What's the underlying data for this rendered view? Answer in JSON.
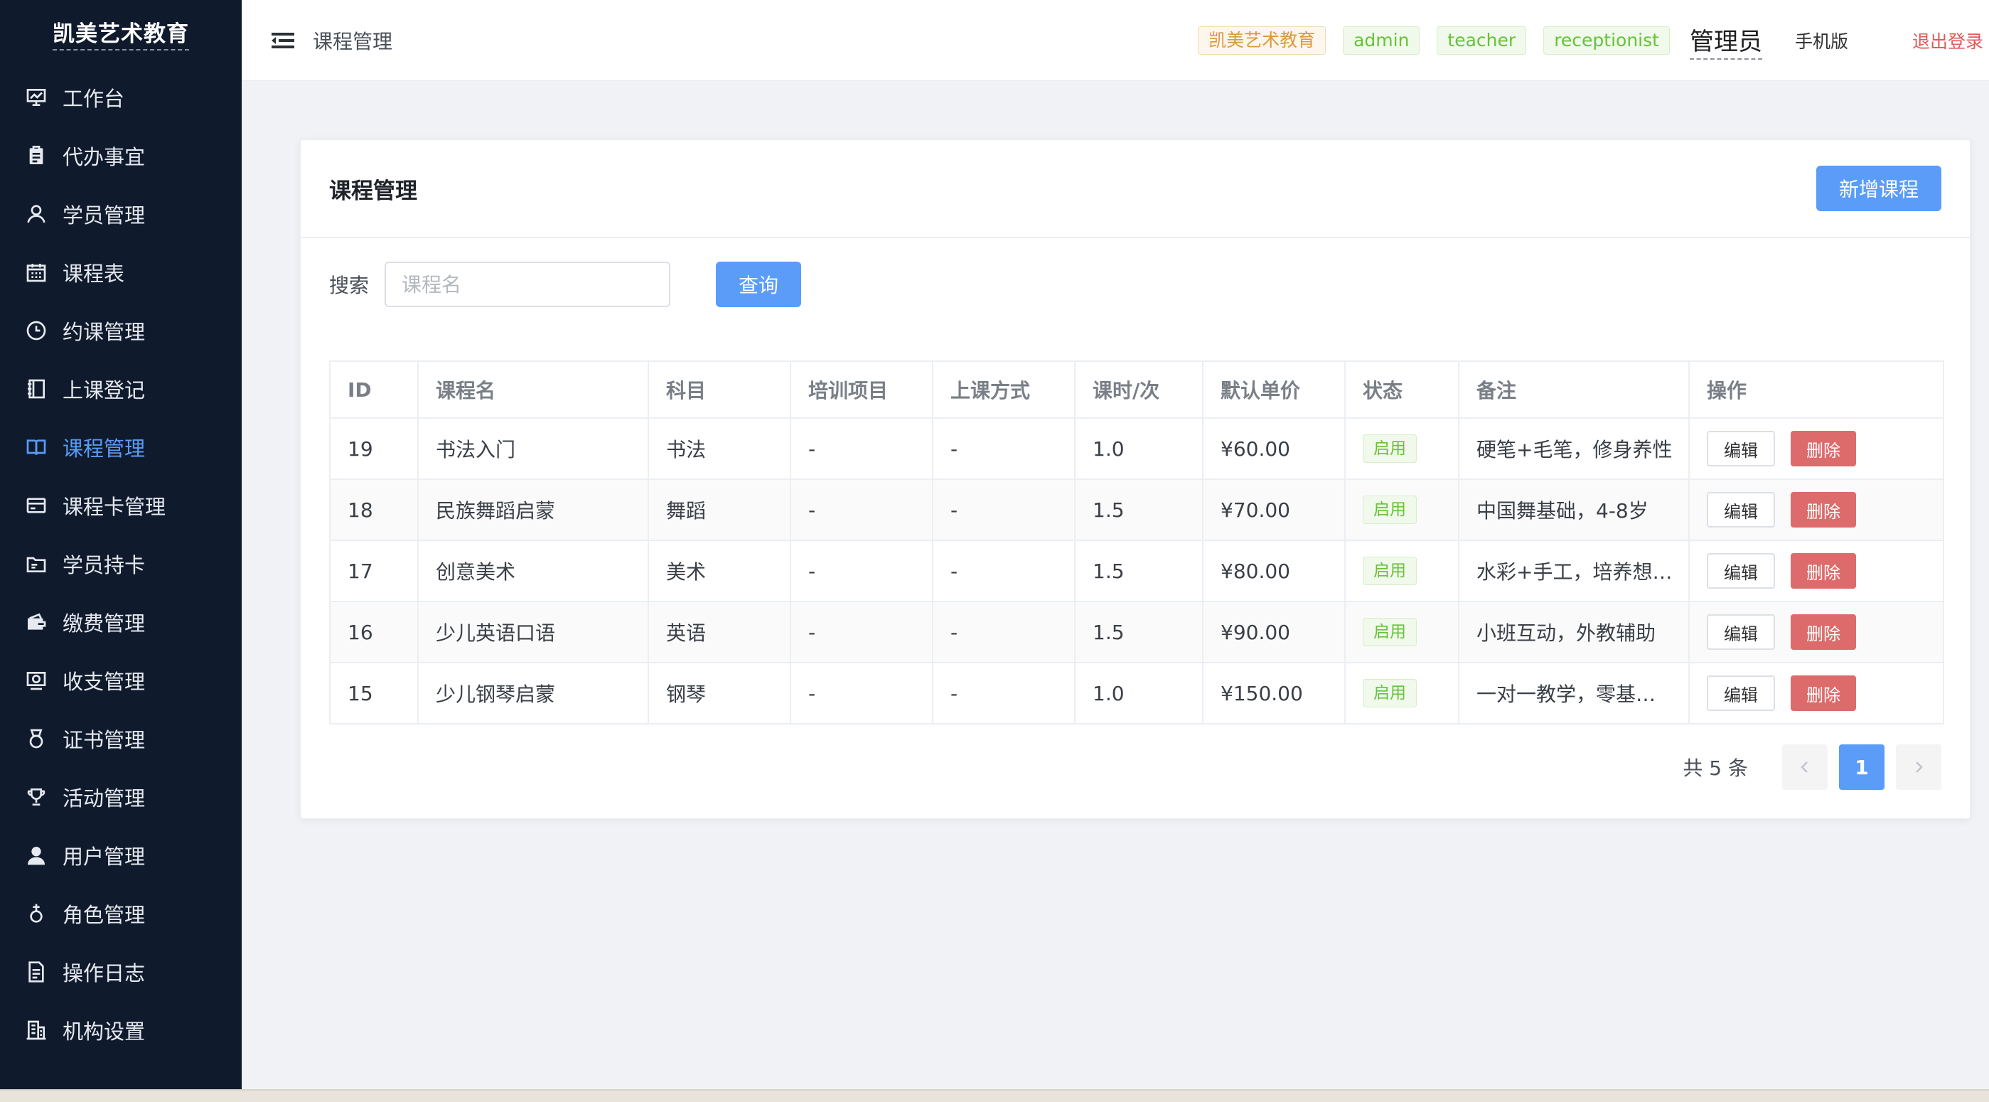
{
  "brand": "凯美艺术教育",
  "sidebar": {
    "items": [
      {
        "label": "工作台",
        "icon": "chart-board-icon"
      },
      {
        "label": "代办事宜",
        "icon": "clipboard-icon"
      },
      {
        "label": "学员管理",
        "icon": "user-icon"
      },
      {
        "label": "课程表",
        "icon": "calendar-icon"
      },
      {
        "label": "约课管理",
        "icon": "clock-icon"
      },
      {
        "label": "上课登记",
        "icon": "notebook-icon"
      },
      {
        "label": "课程管理",
        "icon": "book-open-icon"
      },
      {
        "label": "课程卡管理",
        "icon": "credit-card-icon"
      },
      {
        "label": "学员持卡",
        "icon": "folder-card-icon"
      },
      {
        "label": "缴费管理",
        "icon": "wallet-icon"
      },
      {
        "label": "收支管理",
        "icon": "finance-icon"
      },
      {
        "label": "证书管理",
        "icon": "medal-icon"
      },
      {
        "label": "活动管理",
        "icon": "trophy-icon"
      },
      {
        "label": "用户管理",
        "icon": "user-filled-icon"
      },
      {
        "label": "角色管理",
        "icon": "female-icon"
      },
      {
        "label": "操作日志",
        "icon": "document-icon"
      },
      {
        "label": "机构设置",
        "icon": "office-building-icon"
      }
    ],
    "active_index": 6,
    "active_color": "#5b9bf6"
  },
  "header": {
    "breadcrumb": "课程管理",
    "tags": {
      "org": "凯美艺术教育",
      "role1": "admin",
      "role2": "teacher",
      "role3": "receptionist"
    },
    "user_role": "管理员",
    "mobile_link": "手机版",
    "logout": "退出登录"
  },
  "card": {
    "title": "课程管理",
    "add_button": "新增课程",
    "search": {
      "label": "搜索",
      "placeholder": "课程名",
      "value": "",
      "button": "查询"
    }
  },
  "table": {
    "columns": [
      "ID",
      "课程名",
      "科目",
      "培训项目",
      "上课方式",
      "课时/次",
      "默认单价",
      "状态",
      "备注",
      "操作"
    ],
    "rows": [
      {
        "id": "19",
        "name": "书法入门",
        "subject": "书法",
        "project": "-",
        "mode": "-",
        "hours": "1.0",
        "price": "¥60.00",
        "status": "启用",
        "remark": "硬笔+毛笔，修身养性"
      },
      {
        "id": "18",
        "name": "民族舞蹈启蒙",
        "subject": "舞蹈",
        "project": "-",
        "mode": "-",
        "hours": "1.5",
        "price": "¥70.00",
        "status": "启用",
        "remark": "中国舞基础，4-8岁"
      },
      {
        "id": "17",
        "name": "创意美术",
        "subject": "美术",
        "project": "-",
        "mode": "-",
        "hours": "1.5",
        "price": "¥80.00",
        "status": "启用",
        "remark": "水彩+手工，培养想…"
      },
      {
        "id": "16",
        "name": "少儿英语口语",
        "subject": "英语",
        "project": "-",
        "mode": "-",
        "hours": "1.5",
        "price": "¥90.00",
        "status": "启用",
        "remark": "小班互动，外教辅助"
      },
      {
        "id": "15",
        "name": "少儿钢琴启蒙",
        "subject": "钢琴",
        "project": "-",
        "mode": "-",
        "hours": "1.0",
        "price": "¥150.00",
        "status": "启用",
        "remark": "一对一教学，零基…"
      }
    ],
    "edit_label": "编辑",
    "delete_label": "删除"
  },
  "pagination": {
    "total_text": "共 5 条",
    "current_page": "1"
  },
  "colors": {
    "sidebar_bg": "#0f1b2d",
    "primary": "#5a9cf8",
    "danger": "#dd6b6b",
    "success": "#67c23a",
    "warning": "#d99a3e"
  }
}
